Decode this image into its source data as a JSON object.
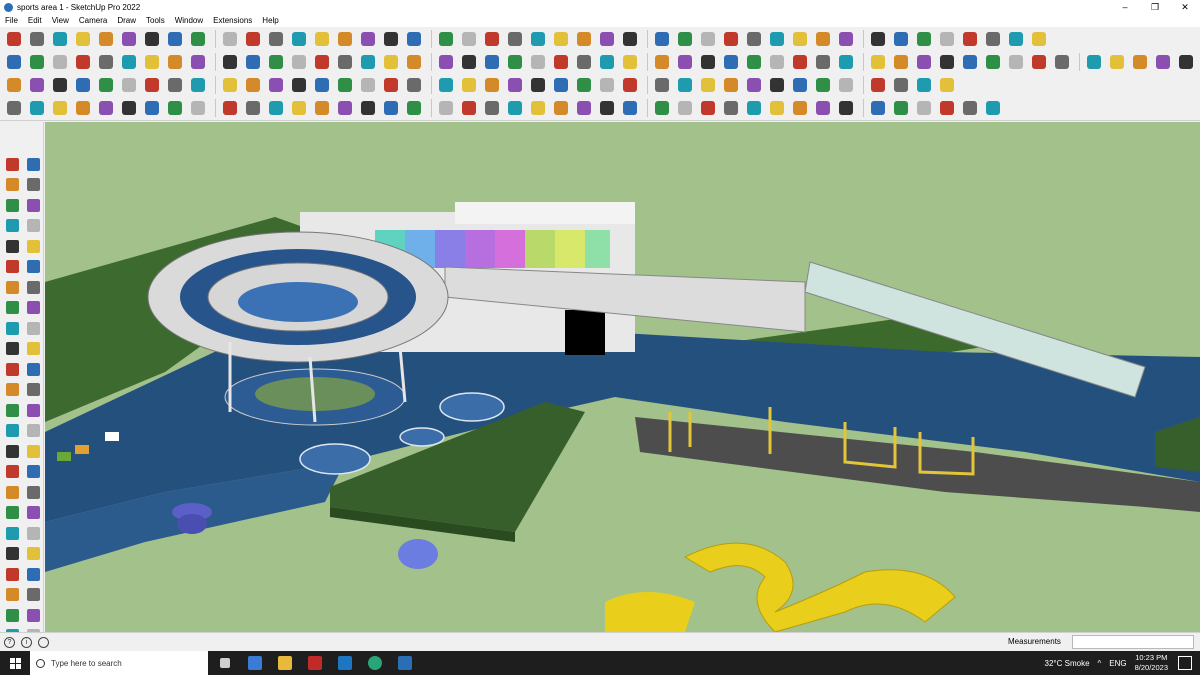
{
  "window": {
    "title": "sports area 1 - SketchUp Pro 2022",
    "minimize": "–",
    "restore": "❐",
    "close": "✕"
  },
  "menu": {
    "items": [
      "File",
      "Edit",
      "View",
      "Camera",
      "Draw",
      "Tools",
      "Window",
      "Extensions",
      "Help"
    ]
  },
  "status": {
    "measurements_label": "Measurements",
    "measurements_value": ""
  },
  "taskbar": {
    "search_placeholder": "Type here to search",
    "weather": "32°C  Smoke",
    "language": "ENG",
    "time": "10:23 PM",
    "date": "8/20/2023"
  },
  "colors": {
    "sky": "#a3c18a",
    "water": "#24507e",
    "grass": "#3c6a2d",
    "accent": "#2a6fb5"
  },
  "icons": {
    "toolbar": [
      "search-icon",
      "select-icon",
      "eraser-icon",
      "pencil-icon",
      "paint-icon",
      "move-icon",
      "rotate-icon",
      "zoom-icon",
      "orbit-icon",
      "pan-icon",
      "camera-icon"
    ],
    "left": [
      "select-icon",
      "orbit-icon",
      "paint-bucket-icon",
      "eraser-icon",
      "line-icon",
      "arc-icon",
      "rectangle-icon",
      "circle-icon",
      "polygon-icon",
      "move-icon",
      "rotate-icon",
      "scale-icon",
      "offset-icon",
      "tape-icon",
      "text-icon",
      "axes-icon",
      "zoom-icon",
      "walk-icon"
    ]
  }
}
